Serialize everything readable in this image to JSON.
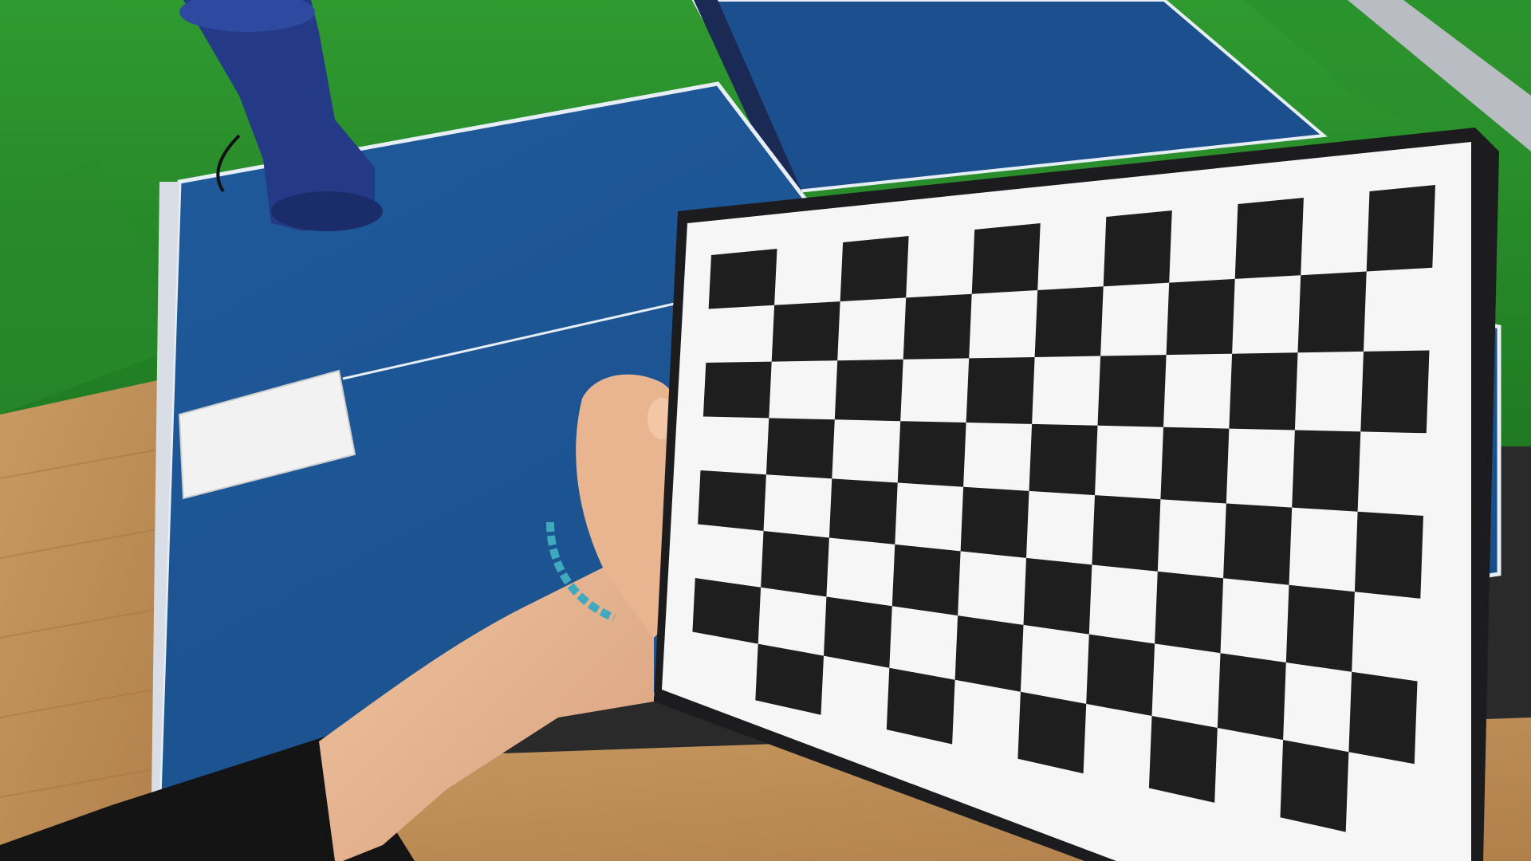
{
  "scene": {
    "description_visible_text": "",
    "colors": {
      "green_screen": "#2f9a30",
      "green_screen_dark": "#1f7a22",
      "table_blue": "#1f5a9c",
      "table_blue_dark": "#194c86",
      "table_line": "#e8eef5",
      "floor_wood": "#c99a62",
      "floor_wood_dark": "#b07f4a",
      "board_frame": "#1c1c1e",
      "board_paper": "#f6f6f6",
      "checker_dark": "#1e1e1e",
      "skin": "#e8b896",
      "shirt": "#141414",
      "bracelet": "#3fa9c0",
      "net_post": "#1d2f6a",
      "paper_sheet": "#f2f2f2",
      "metal_rail": "#b9bcc2"
    },
    "checkerboard": {
      "rows": 8,
      "cols": 11
    }
  }
}
